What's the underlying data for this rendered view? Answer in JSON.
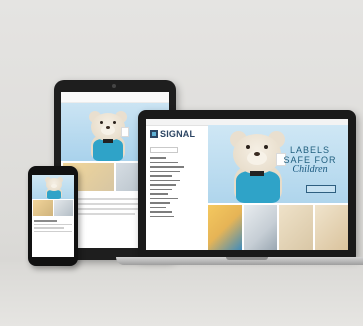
{
  "scene": {
    "background_color": "#e2e1de",
    "accent_color": "#2fa3c8",
    "brand_color": "#2c4563"
  },
  "laptop": {
    "brand": {
      "name": "SIGNAL",
      "logo_icon": "signal-square-icon"
    },
    "hero": {
      "line1": "LABELS",
      "line2": "SAFE FOR",
      "line3": "Children"
    },
    "menu_item_count": 14,
    "tile_count": 4
  },
  "tablet": {
    "hero_image": "teddy-bear-photo"
  },
  "phone": {
    "hero_image": "teddy-bear-photo"
  }
}
